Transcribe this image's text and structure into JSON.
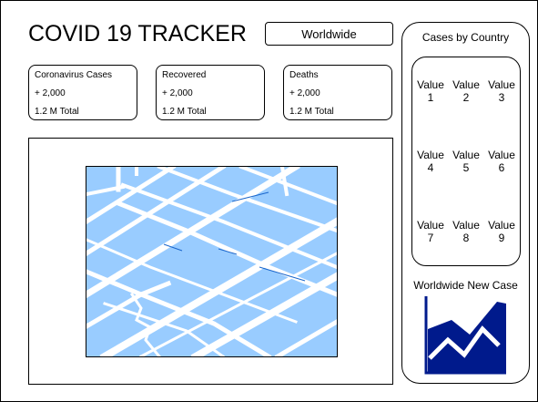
{
  "header": {
    "title": "COVID 19 TRACKER"
  },
  "region_select": {
    "value": "Worldwide"
  },
  "stats": [
    {
      "label": "Coronavirus Cases",
      "change": "+ 2,000",
      "total": "1.2 M Total"
    },
    {
      "label": "Recovered",
      "change": "+ 2,000",
      "total": "1.2 M Total"
    },
    {
      "label": "Deaths",
      "change": "+ 2,000",
      "total": "1.2 M Total"
    }
  ],
  "map": {
    "icon": "map-icon",
    "colors": {
      "water": "#99ccff",
      "land": "#ffffff",
      "border": "#000000"
    }
  },
  "country_panel": {
    "title": "Cases by Country",
    "cells": [
      {
        "label": "Value",
        "num": "1"
      },
      {
        "label": "Value",
        "num": "2"
      },
      {
        "label": "Value",
        "num": "3"
      },
      {
        "label": "Value",
        "num": "4"
      },
      {
        "label": "Value",
        "num": "5"
      },
      {
        "label": "Value",
        "num": "6"
      },
      {
        "label": "Value",
        "num": "7"
      },
      {
        "label": "Value",
        "num": "8"
      },
      {
        "label": "Value",
        "num": "9"
      }
    ]
  },
  "new_case": {
    "title": "Worldwide New Case",
    "icon": "area-chart-icon",
    "color": "#001a8c"
  }
}
